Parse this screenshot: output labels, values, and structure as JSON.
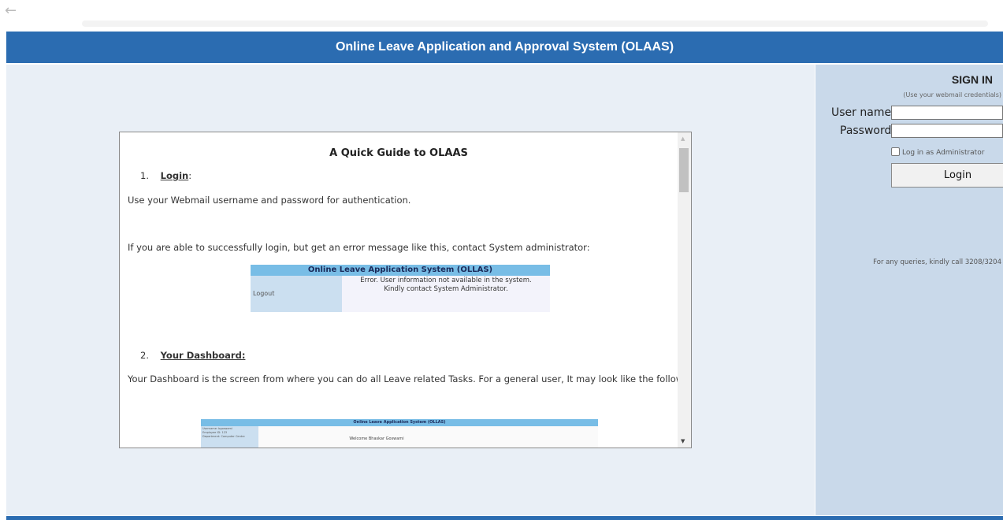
{
  "browser": {
    "back_icon": "arrow-left-icon"
  },
  "header": {
    "title": "Online Leave Application and Approval System (OLAAS)"
  },
  "guide": {
    "title": "A Quick Guide to OLAAS",
    "step1": {
      "num": "1.",
      "label": "Login",
      "suffix": ":"
    },
    "para1": "Use your Webmail username and password for authentication.",
    "para2": "If you are able to successfully login, but get an error message like this, contact System administrator:",
    "error_sample": {
      "title": "Online Leave Application System (OLLAS)",
      "logout": "Logout",
      "message_line1": "Error. User information not available in the system.",
      "message_line2": "Kindly contact System Administrator."
    },
    "step2": {
      "num": "2.",
      "label": "Your Dashboard:"
    },
    "para3": "Your Dashboard is the screen from where you can do all Leave related Tasks. For a general user, It may look like the following:",
    "dashboard_sample": {
      "title": "Online Leave Application System (OLLAS)",
      "side_line1": "Username: bgoswami",
      "side_line2": "Employee ID: 123",
      "side_line3": "Department: Computer Centre",
      "welcome": "Welcome Bhaskar Goswami"
    }
  },
  "signin": {
    "title": "SIGN IN",
    "subtitle": "(Use your webmail credentials)",
    "username_label": "User name:",
    "username_value": "",
    "password_label": "Password:",
    "password_value": "",
    "admin_checkbox_label": "Log in as Administrator",
    "admin_checked": false,
    "login_button": "Login",
    "queries_text": "For any queries, kindly call 3208/3204"
  }
}
